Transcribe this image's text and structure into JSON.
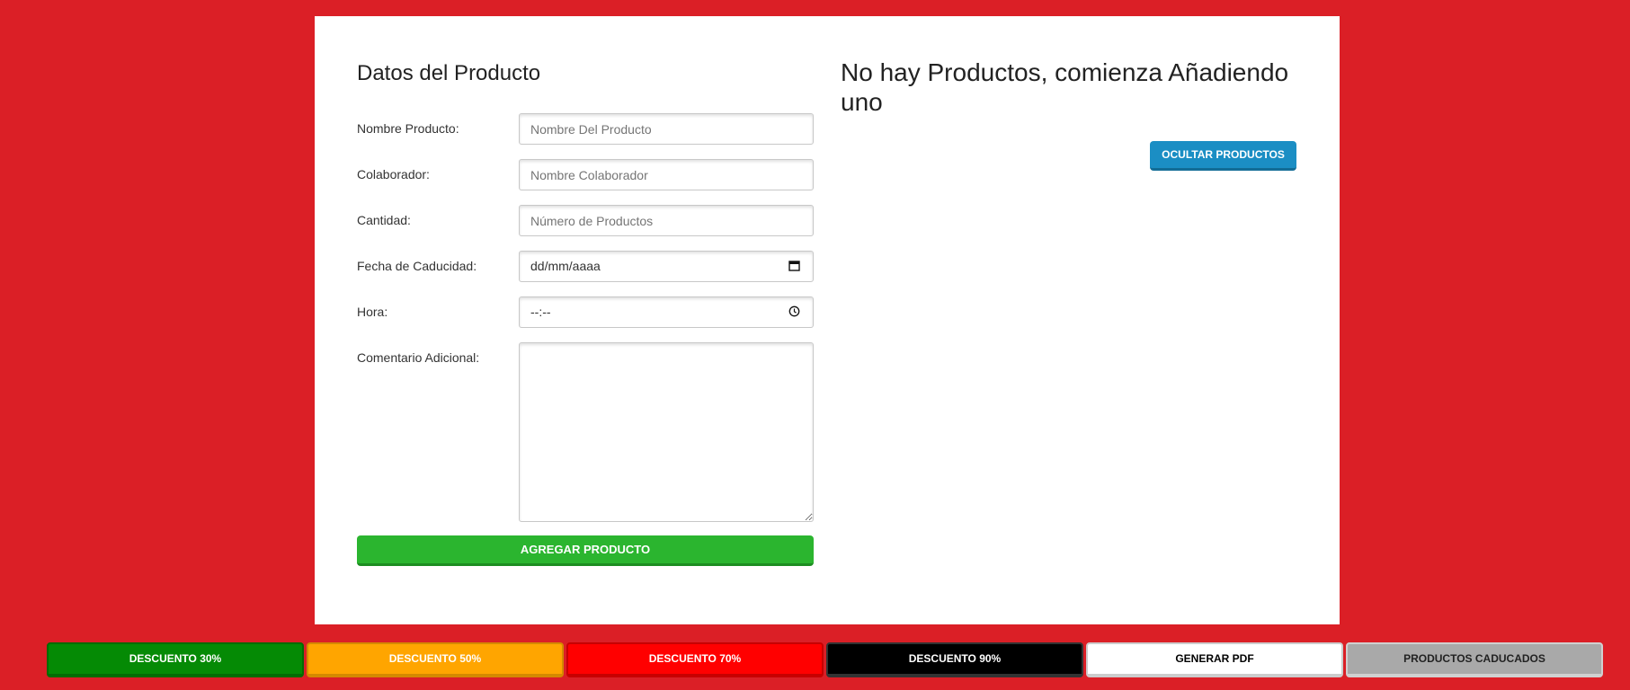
{
  "form": {
    "title": "Datos del Producto",
    "fields": [
      {
        "label": "Nombre Producto:",
        "placeholder": "Nombre Del Producto"
      },
      {
        "label": "Colaborador:",
        "placeholder": "Nombre Colaborador"
      },
      {
        "label": "Cantidad:",
        "placeholder": "Número de Productos"
      },
      {
        "label": "Fecha de Caducidad:",
        "value": "dd/mm/aaaa"
      },
      {
        "label": "Hora:",
        "value": "--:--"
      },
      {
        "label": "Comentario Adicional:",
        "value": ""
      }
    ],
    "submit_label": "AGREGAR PRODUCTO"
  },
  "products": {
    "empty_message": "No hay Productos, comienza Añadiendo uno",
    "hide_label": "OCULTAR PRODUCTOS"
  },
  "bottom_bar": {
    "buttons": [
      {
        "label": "DESCUENTO 30%",
        "bg": "#058a05",
        "fg": "#ffffff",
        "border": "#046b04"
      },
      {
        "label": "DESCUENTO 50%",
        "bg": "#ffa500",
        "fg": "#ffffff",
        "border": "#d48900"
      },
      {
        "label": "DESCUENTO 70%",
        "bg": "#ff0000",
        "fg": "#ffffff",
        "border": "#c70000"
      },
      {
        "label": "DESCUENTO 90%",
        "bg": "#000000",
        "fg": "#ffffff",
        "border": "#333333"
      },
      {
        "label": "GENERAR PDF",
        "bg": "#ffffff",
        "fg": "#000000",
        "border": "#cccccc"
      },
      {
        "label": "PRODUCTOS CADUCADOS",
        "bg": "#a9a9a9",
        "fg": "#222222",
        "border": "#d0d0d0"
      }
    ]
  },
  "colors": {
    "page_bg": "#db1f26",
    "add_button": "#2bb52f",
    "hide_button": "#1b8ec4"
  }
}
